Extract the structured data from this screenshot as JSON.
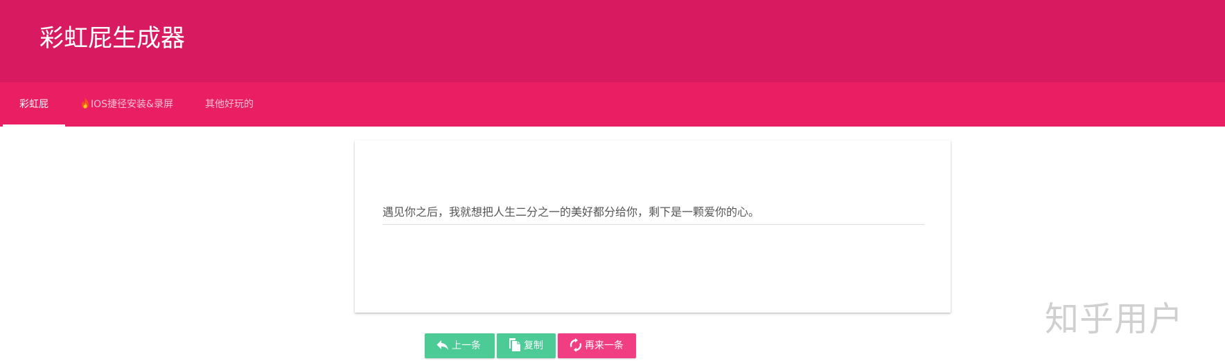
{
  "app": {
    "title": "彩虹屁生成器"
  },
  "tabs": [
    {
      "label": "彩虹屁",
      "active": true
    },
    {
      "label": "IOS捷径安装&录屏",
      "icon": "fire-icon",
      "active": false
    },
    {
      "label": "其他好玩的",
      "active": false
    }
  ],
  "card": {
    "compliment_text": "遇见你之后，我就想把人生二分之一的美好都分给你，剩下是一颗爱你的心。"
  },
  "actions": {
    "prev": {
      "label": "上一条",
      "icon": "reply-arrow-icon"
    },
    "copy": {
      "label": "复制",
      "icon": "copy-icon"
    },
    "next": {
      "label": "再来一条",
      "icon": "refresh-icon"
    }
  },
  "watermark": {
    "text": "知乎用户"
  },
  "colors": {
    "header": "#d81b60",
    "tabbar": "#e91e63",
    "button_green": "#4ccb96",
    "button_pink": "#f13d82"
  }
}
